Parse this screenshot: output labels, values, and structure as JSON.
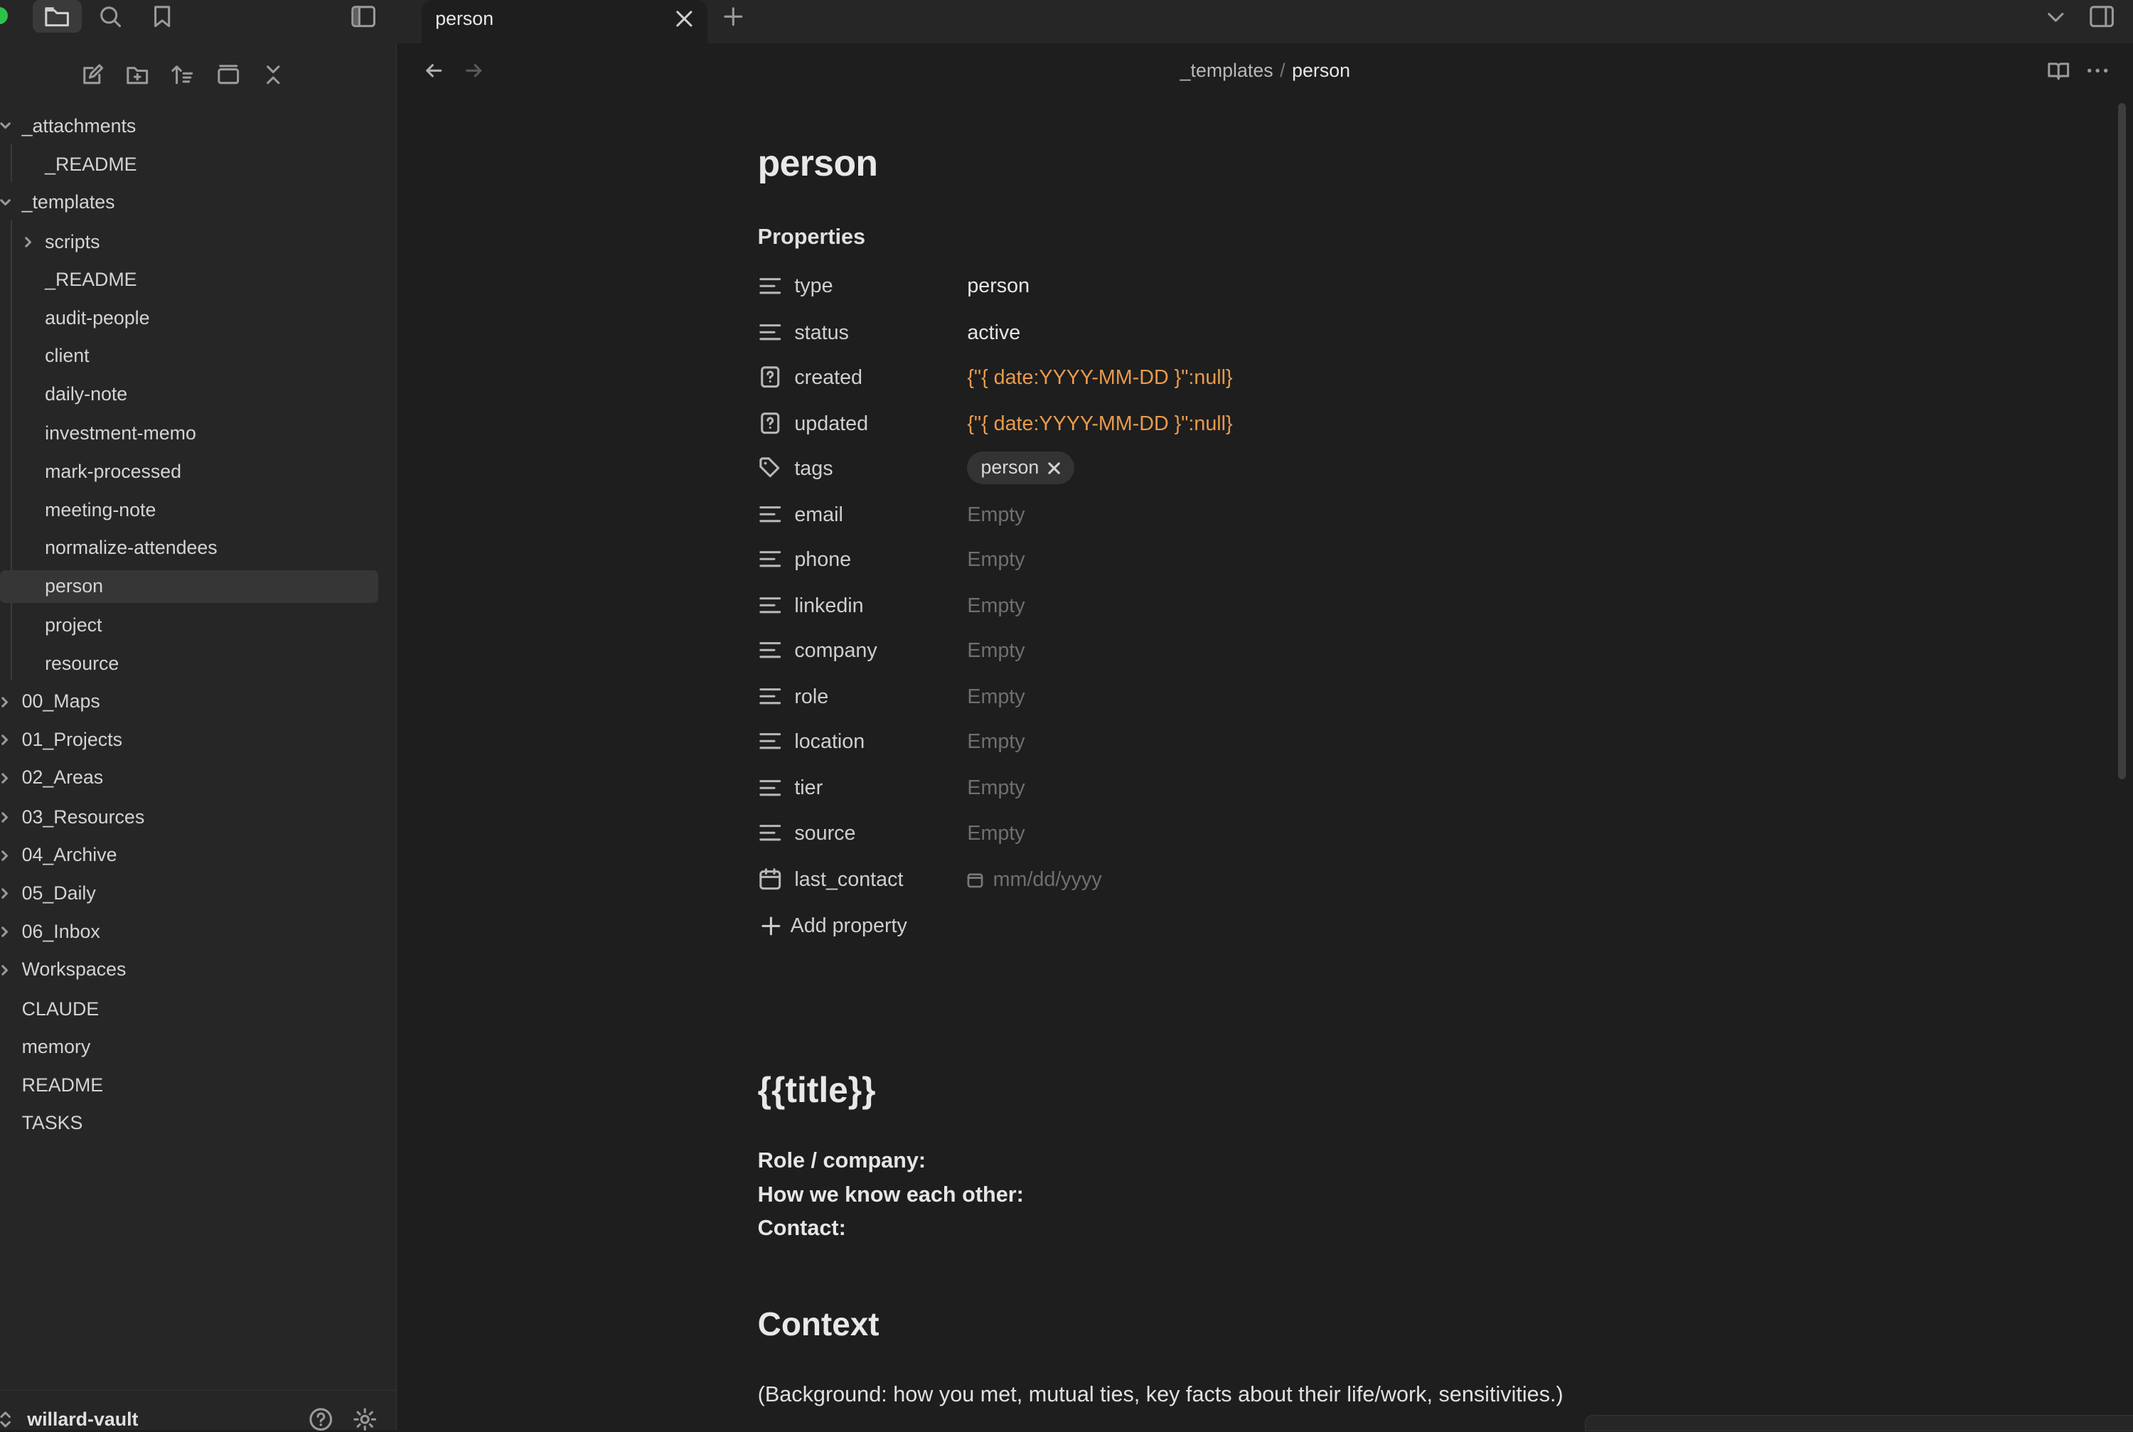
{
  "tab": {
    "title": "person"
  },
  "breadcrumb": {
    "folder": "_templates",
    "separator": "/",
    "current": "person"
  },
  "sidebar": {
    "tree": [
      {
        "label": "_attachments",
        "level": 0,
        "expanded": true
      },
      {
        "label": "_README",
        "level": 1
      },
      {
        "label": "_templates",
        "level": 0,
        "expanded": true
      },
      {
        "label": "scripts",
        "level": 1,
        "folder": true
      },
      {
        "label": "_README",
        "level": 1
      },
      {
        "label": "audit-people",
        "level": 1
      },
      {
        "label": "client",
        "level": 1
      },
      {
        "label": "daily-note",
        "level": 1
      },
      {
        "label": "investment-memo",
        "level": 1
      },
      {
        "label": "mark-processed",
        "level": 1
      },
      {
        "label": "meeting-note",
        "level": 1
      },
      {
        "label": "normalize-attendees",
        "level": 1
      },
      {
        "label": "person",
        "level": 1,
        "selected": true
      },
      {
        "label": "project",
        "level": 1
      },
      {
        "label": "resource",
        "level": 1
      },
      {
        "label": "00_Maps",
        "level": 0,
        "folder": true
      },
      {
        "label": "01_Projects",
        "level": 0,
        "folder": true
      },
      {
        "label": "02_Areas",
        "level": 0,
        "folder": true
      },
      {
        "label": "03_Resources",
        "level": 0,
        "folder": true
      },
      {
        "label": "04_Archive",
        "level": 0,
        "folder": true
      },
      {
        "label": "05_Daily",
        "level": 0,
        "folder": true
      },
      {
        "label": "06_Inbox",
        "level": 0,
        "folder": true
      },
      {
        "label": "Workspaces",
        "level": 0,
        "folder": true
      },
      {
        "label": "CLAUDE",
        "level": 0
      },
      {
        "label": "memory",
        "level": 0
      },
      {
        "label": "README",
        "level": 0
      },
      {
        "label": "TASKS",
        "level": 0
      }
    ],
    "vault_name": "willard-vault"
  },
  "note": {
    "title": "person",
    "properties_heading": "Properties",
    "properties": [
      {
        "key": "type",
        "value": "person",
        "icon": "text-icon",
        "kind": "text"
      },
      {
        "key": "status",
        "value": "active",
        "icon": "text-icon",
        "kind": "text"
      },
      {
        "key": "created",
        "value": "{\"{ date:YYYY-MM-DD }\":null}",
        "icon": "unknown-type-icon",
        "kind": "code"
      },
      {
        "key": "updated",
        "value": "{\"{ date:YYYY-MM-DD }\":null}",
        "icon": "unknown-type-icon",
        "kind": "code"
      },
      {
        "key": "tags",
        "value": "person",
        "icon": "tags-icon",
        "kind": "tag"
      },
      {
        "key": "email",
        "value": "Empty",
        "icon": "text-icon",
        "kind": "empty"
      },
      {
        "key": "phone",
        "value": "Empty",
        "icon": "text-icon",
        "kind": "empty"
      },
      {
        "key": "linkedin",
        "value": "Empty",
        "icon": "text-icon",
        "kind": "empty"
      },
      {
        "key": "company",
        "value": "Empty",
        "icon": "text-icon",
        "kind": "empty"
      },
      {
        "key": "role",
        "value": "Empty",
        "icon": "text-icon",
        "kind": "empty"
      },
      {
        "key": "location",
        "value": "Empty",
        "icon": "text-icon",
        "kind": "empty"
      },
      {
        "key": "tier",
        "value": "Empty",
        "icon": "text-icon",
        "kind": "empty"
      },
      {
        "key": "source",
        "value": "Empty",
        "icon": "text-icon",
        "kind": "empty"
      },
      {
        "key": "last_contact",
        "value": "mm/dd/yyyy",
        "icon": "calendar-icon",
        "kind": "date"
      }
    ],
    "add_property_label": "Add property",
    "body": {
      "title": "{{title}}",
      "lines": [
        "Role / company:",
        "How we know each other:",
        "Contact:"
      ],
      "context_heading": "Context",
      "context_text": "(Background: how you met, mutual ties, key facts about their life/work, sensitivities.)"
    }
  },
  "colors": {
    "accent_green": "#2ec346",
    "code_orange": "#e89a4c",
    "background": "#1e1e1e",
    "sidebar": "#262626"
  }
}
